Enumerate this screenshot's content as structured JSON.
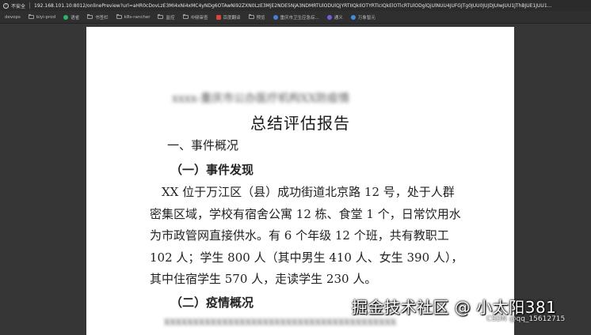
{
  "browser": {
    "security_label": "不安全",
    "url": "192.168.101.10:8012/onlinePreview?url=aHR0cDovLzE3MI4xNi4xMC4yNDg6OTAwNi92ZXN0LzE3MjE2NDE5NjA3NDMRTUlODUlQjYRTIIQkIlOTYRTlcIQkElOTlcRTUlODglQjUlNUU4JUFGJTg0JUU0JUJDJUIwJUU1JThBJUE1JUU1..."
  },
  "bookmarks": [
    {
      "label": "devops",
      "icon": "none"
    },
    {
      "label": "biyi-prod",
      "icon": "folder-icon"
    },
    {
      "label": "语雀",
      "icon": "green-dot-icon"
    },
    {
      "label": "书签栏",
      "icon": "folder-icon"
    },
    {
      "label": "k8s-rancher",
      "icon": "folder-icon"
    },
    {
      "label": "监控",
      "icon": "folder-icon"
    },
    {
      "label": "中频审查",
      "icon": "folder-icon"
    },
    {
      "label": "百度翻译",
      "icon": "red-square-icon"
    },
    {
      "label": "预览",
      "icon": "folder-icon"
    },
    {
      "label": "重庆市卫生应急综...",
      "icon": "blue-figure-icon"
    },
    {
      "label": "通义",
      "icon": "purple-dot-icon"
    },
    {
      "label": "万象智元",
      "icon": "blue-dot-icon"
    }
  ],
  "document": {
    "header_obscured": "xxxx-重庆市公办医疗机构XX防疫情",
    "title": "总结评估报告",
    "section1": "一、事件概况",
    "subsection1": "（一）事件发现",
    "paragraph_lines": [
      "　XX 位于万江区（县）成功街道北京路 12 号，处于人群",
      "密集区域，学校有宿舍公寓 12 栋、食堂 1 个，日常饮用水",
      "为市政管网直接供水。有 6 个年级 12 个班，共有教职工",
      "102 人；学生 800 人（其中男生 410 人、女生 390 人），",
      "其中住宿学生 570 人，走读学生 230 人。"
    ],
    "subsection2": "（二）疫情概况",
    "obscured_line": "xxxxxxxxxxxxxxxxxxxxxxxxxxxxxxxxxxxxxxxx"
  },
  "watermark": {
    "main": "掘金技术社区 @ 小太阳381",
    "sub": "CSDN @qq_15612715"
  },
  "colors": {
    "background": "#363636",
    "page": "#ffffff",
    "text": "#222222"
  }
}
